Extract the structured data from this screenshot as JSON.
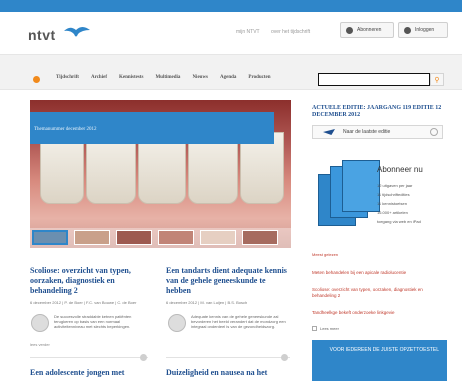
{
  "brand": {
    "logo_text": "ntvt"
  },
  "header": {
    "links": [
      "mijn NTVT",
      "over het tijdschrift"
    ],
    "buttons": {
      "abonneren": "Abonneren",
      "inloggen": "Inloggen"
    }
  },
  "nav": {
    "items": [
      "Tijdschrift",
      "Archief",
      "Kennistests",
      "Multimedia",
      "Nieuws",
      "Agenda",
      "Producten"
    ],
    "search_placeholder": ""
  },
  "hero": {
    "caption": "Themanummer december 2012"
  },
  "articles": [
    {
      "title": "Scoliose: overzicht van typen, oorzaken, diagnostiek en behandeling 2",
      "meta": "6 december 2012 | P. de Boer | F.C. van Bouwe | C. de Boer",
      "text": "De succesvolle straddable ketnen patiënten terugkeren op basis van een normaal activiteitenniveau met slechts beperkingen.",
      "readmore": "lees verder"
    },
    {
      "title": "Een tandarts dient adequate kennis van de gehele geneeskunde te hebben",
      "meta": "6 december 2012 | M. van Luijen | B.S. Bosch",
      "text": "Adequate kennis van de gehele geneeskunde zal bevorderen het beeld verandert dat de mondzorg een integraal onderdeel is van de gezondheidszorg.",
      "readmore": ""
    }
  ],
  "next_articles": [
    {
      "title": "Een adolescente jongen met"
    },
    {
      "title": "Duizeligheid en nausea na het"
    }
  ],
  "sidebar": {
    "edition_heading": "ACTUELE EDITIE: JAARGANG 119 EDITIE 12 DECEMBER 2012",
    "latest_button": "Naar de laatste editie",
    "subscription": {
      "title": "Abonneer nu",
      "items": [
        "12 uitgaven per jaar",
        "11 tijdschriftedities",
        "11 kennistoetsen",
        "16.000+ artikelen",
        "toegang via web en iPad"
      ]
    },
    "links_heading": "Meest gelezen",
    "links": [
      "Meten behandelen bij een apicale radiolucentie",
      "Scoliose: overzicht van typen, oorzaken, diagnostiek en behandeling 2",
      "Tandheelkge bekeft onderzoeke linkgevie"
    ],
    "toggle_label": "Lees meer",
    "ad_text": "VOOR IEDEREEN DE JUISTE OPZETTOESTEL"
  },
  "colors": {
    "accent": "#2f86c9",
    "link": "#c0392b",
    "title": "#1f4f8f",
    "home_icon": "#f18a1c"
  }
}
